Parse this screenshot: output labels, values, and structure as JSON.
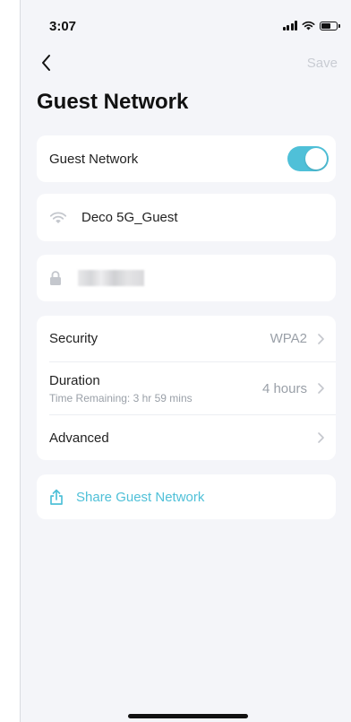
{
  "status_bar": {
    "time": "3:07"
  },
  "nav": {
    "save_label": "Save"
  },
  "page": {
    "title": "Guest Network"
  },
  "guest_toggle": {
    "label": "Guest Network",
    "enabled": true
  },
  "network": {
    "ssid": "Deco 5G_Guest"
  },
  "settings": {
    "security": {
      "label": "Security",
      "value": "WPA2"
    },
    "duration": {
      "label": "Duration",
      "sub": "Time Remaining: 3 hr 59 mins",
      "value": "4 hours"
    },
    "advanced": {
      "label": "Advanced"
    }
  },
  "share": {
    "label": "Share Guest Network"
  },
  "colors": {
    "accent": "#4fc0d8",
    "background": "#f4f5f9"
  },
  "icons": [
    "back-arrow-icon",
    "wifi-icon",
    "lock-icon",
    "chevron-right-icon",
    "share-icon",
    "signal-icon",
    "battery-icon"
  ]
}
